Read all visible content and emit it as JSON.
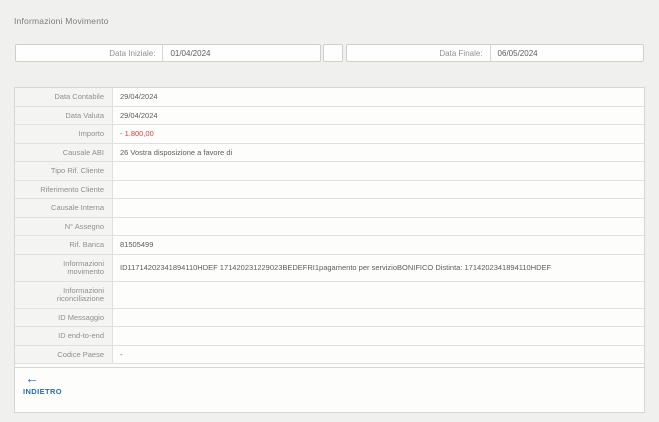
{
  "page": {
    "title": "Informazioni Movimento"
  },
  "date_filter": {
    "start_label": "Data Iniziale:",
    "start_value": "01/04/2024",
    "end_label": "Data Finale:",
    "end_value": "06/05/2024"
  },
  "details": {
    "rows": [
      {
        "label": "Data Contabile",
        "value": "29/04/2024"
      },
      {
        "label": "Data Valuta",
        "value": "29/04/2024"
      },
      {
        "label": "Importo",
        "value": "- 1.800,00",
        "color": "#e23b42"
      },
      {
        "label": "Causale ABI",
        "value": "26 Vostra disposizione a favore di"
      },
      {
        "label": "Tipo Rif. Cliente",
        "value": ""
      },
      {
        "label": "Riferimento Cliente",
        "value": ""
      },
      {
        "label": "Causale Interna",
        "value": ""
      },
      {
        "label": "N° Assegno",
        "value": ""
      },
      {
        "label": "Rif. Banca",
        "value": "81505499"
      },
      {
        "label": "Informazioni movimento",
        "value": "ID11714202341894110HDEF 171420231229023BEDEFRI1pagamento per servizioBONIFICO Distinta: 1714202341894110HDEF"
      },
      {
        "label": "Informazioni riconciliazione",
        "value": ""
      },
      {
        "label": "ID Messaggio",
        "value": ""
      },
      {
        "label": "ID end-to-end",
        "value": ""
      },
      {
        "label": "Codice Paese",
        "value": "-"
      }
    ]
  },
  "footer": {
    "back_icon": "arrow-left",
    "back_label": "INDIETRO"
  },
  "colors": {
    "accent_blue": "#2a6cba",
    "negative_red": "#e23b42",
    "page_background": "#f0f0ee"
  }
}
